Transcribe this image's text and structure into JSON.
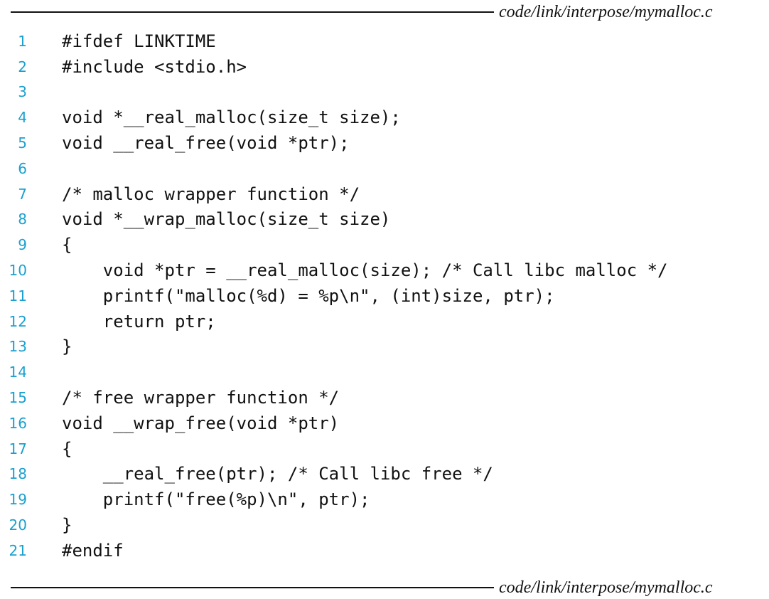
{
  "header": {
    "filename": "code/link/interpose/mymalloc.c"
  },
  "footer": {
    "filename": "code/link/interpose/mymalloc.c"
  },
  "code": {
    "lines": [
      {
        "num": "1",
        "text": "#ifdef LINKTIME"
      },
      {
        "num": "2",
        "text": "#include <stdio.h>"
      },
      {
        "num": "3",
        "text": ""
      },
      {
        "num": "4",
        "text": "void *__real_malloc(size_t size);"
      },
      {
        "num": "5",
        "text": "void __real_free(void *ptr);"
      },
      {
        "num": "6",
        "text": ""
      },
      {
        "num": "7",
        "text": "/* malloc wrapper function */"
      },
      {
        "num": "8",
        "text": "void *__wrap_malloc(size_t size)"
      },
      {
        "num": "9",
        "text": "{"
      },
      {
        "num": "10",
        "text": "    void *ptr = __real_malloc(size); /* Call libc malloc */"
      },
      {
        "num": "11",
        "text": "    printf(\"malloc(%d) = %p\\n\", (int)size, ptr);"
      },
      {
        "num": "12",
        "text": "    return ptr;"
      },
      {
        "num": "13",
        "text": "}"
      },
      {
        "num": "14",
        "text": ""
      },
      {
        "num": "15",
        "text": "/* free wrapper function */"
      },
      {
        "num": "16",
        "text": "void __wrap_free(void *ptr)"
      },
      {
        "num": "17",
        "text": "{"
      },
      {
        "num": "18",
        "text": "    __real_free(ptr); /* Call libc free */"
      },
      {
        "num": "19",
        "text": "    printf(\"free(%p)\\n\", ptr);"
      },
      {
        "num": "20",
        "text": "}"
      },
      {
        "num": "21",
        "text": "#endif"
      }
    ]
  },
  "colors": {
    "line_number": "#1aa0cf",
    "text": "#111111",
    "background": "#ffffff"
  }
}
